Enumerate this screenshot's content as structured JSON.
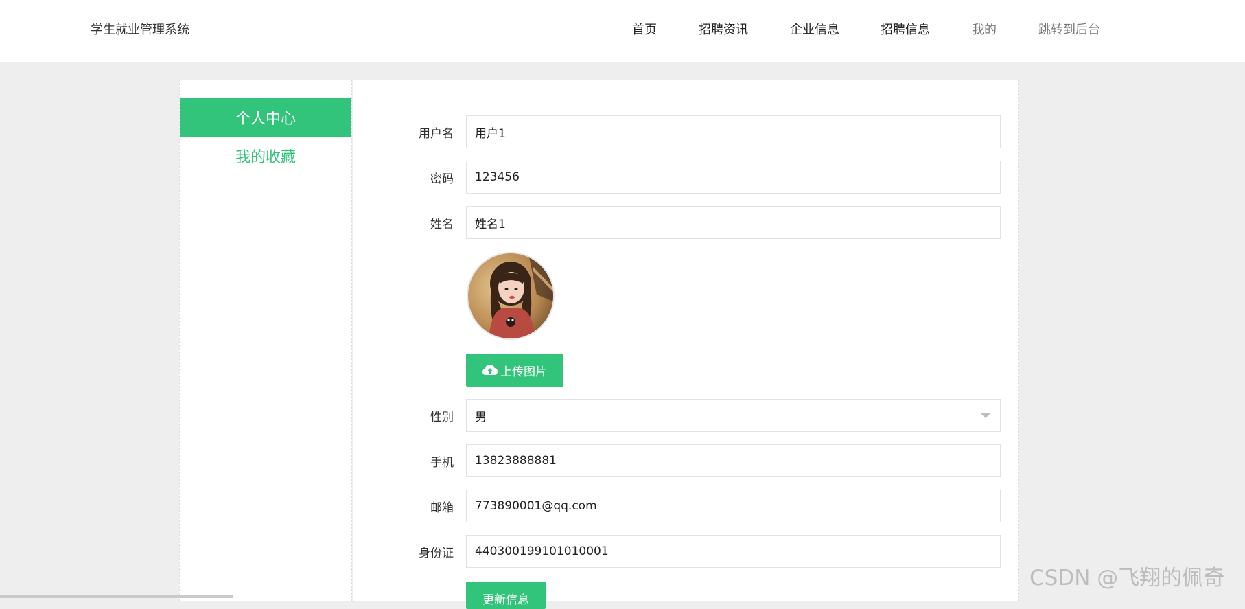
{
  "header": {
    "brand": "学生就业管理系统",
    "nav": [
      {
        "label": "首页"
      },
      {
        "label": "招聘资讯"
      },
      {
        "label": "企业信息"
      },
      {
        "label": "招聘信息"
      },
      {
        "label": "我的"
      },
      {
        "label": "跳转到后台"
      }
    ]
  },
  "sidebar": {
    "items": [
      {
        "label": "个人中心",
        "active": true
      },
      {
        "label": "我的收藏",
        "active": false
      }
    ]
  },
  "form": {
    "username": {
      "label": "用户名",
      "value": "用户1"
    },
    "password": {
      "label": "密码",
      "value": "123456"
    },
    "name": {
      "label": "姓名",
      "value": "姓名1"
    },
    "upload_label": "上传图片",
    "gender": {
      "label": "性别",
      "value": "男"
    },
    "phone": {
      "label": "手机",
      "value": "13823888881"
    },
    "email": {
      "label": "邮箱",
      "value": "773890001@qq.com"
    },
    "id_card": {
      "label": "身份证",
      "value": "440300199101010001"
    },
    "submit_label": "更新信息"
  },
  "watermark": "CSDN @飞翔的佩奇",
  "colors": {
    "accent": "#33c47c",
    "background": "#eeeeee",
    "panel": "#ffffff"
  }
}
